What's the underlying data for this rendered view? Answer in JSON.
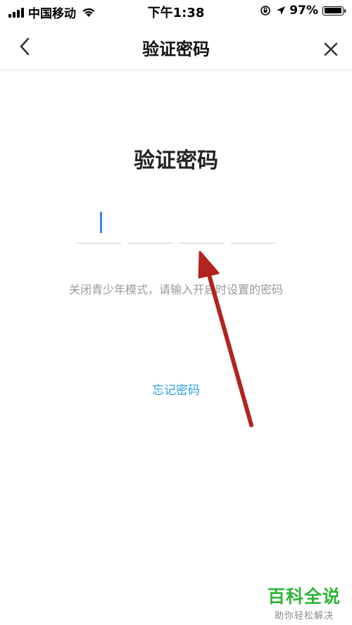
{
  "status_bar": {
    "carrier": "中国移动",
    "time": "下午1:38",
    "battery_percent": "97%",
    "battery_level": 0.97
  },
  "nav": {
    "title": "验证密码",
    "back_icon": "chevron-left-icon",
    "close_icon": "close-icon"
  },
  "main": {
    "heading": "验证密码",
    "pin_length": 4,
    "hint": "关闭青少年模式，请输入开启时设置的密码",
    "forgot_label": "忘记密码"
  },
  "watermark": {
    "title": "百科全说",
    "subtitle": "助你轻松解决"
  },
  "colors": {
    "accent": "#2e9fe8",
    "cursor": "#3b87e8",
    "arrow": "#b3231f",
    "watermark": "#2fb53a"
  }
}
